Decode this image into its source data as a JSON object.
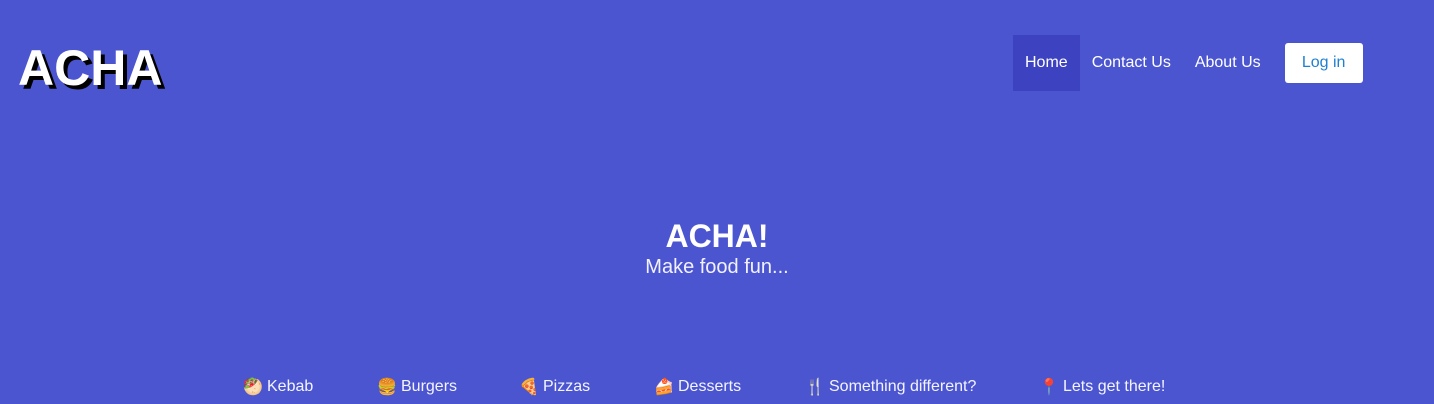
{
  "brand": {
    "logo_text": "ACHA"
  },
  "nav": {
    "items": [
      {
        "label": "Home",
        "active": true
      },
      {
        "label": "Contact Us",
        "active": false
      },
      {
        "label": "About Us",
        "active": false
      }
    ],
    "login_label": "Log in"
  },
  "hero": {
    "title": "ACHA!",
    "subtitle": "Make food fun..."
  },
  "categories": [
    {
      "icon": "🥙",
      "icon_name": "kebab-icon",
      "label": "Kebab"
    },
    {
      "icon": "🍔",
      "icon_name": "burger-icon",
      "label": "Burgers"
    },
    {
      "icon": "🍕",
      "icon_name": "pizza-icon",
      "label": "Pizzas"
    },
    {
      "icon": "🍰",
      "icon_name": "dessert-icon",
      "label": "Desserts"
    },
    {
      "icon": "🍴",
      "icon_name": "cutlery-icon",
      "label": "Something different?"
    },
    {
      "icon": "📍",
      "icon_name": "pin-icon",
      "label": "Lets get there!"
    }
  ],
  "colors": {
    "background": "#4c55d0",
    "nav_active": "#3d43c0",
    "login_text": "#1f7fd0"
  }
}
